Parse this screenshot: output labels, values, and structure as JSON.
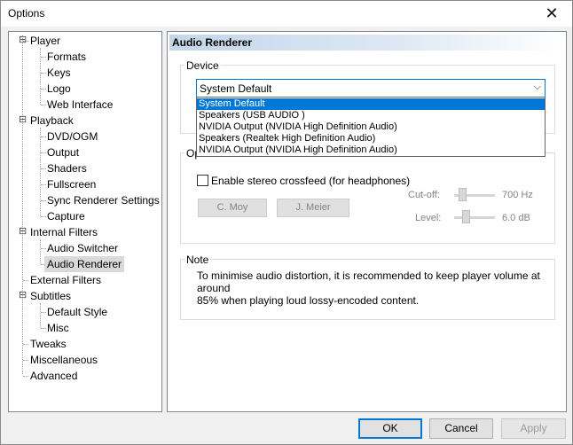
{
  "window": {
    "title": "Options",
    "close_glyph": "✕"
  },
  "tree": {
    "items": [
      {
        "label": "Player",
        "level": 0,
        "expander": "⊟"
      },
      {
        "label": "Formats",
        "level": 1
      },
      {
        "label": "Keys",
        "level": 1
      },
      {
        "label": "Logo",
        "level": 1
      },
      {
        "label": "Web Interface",
        "level": 1
      },
      {
        "label": "Playback",
        "level": 0,
        "expander": "⊟"
      },
      {
        "label": "DVD/OGM",
        "level": 1
      },
      {
        "label": "Output",
        "level": 1
      },
      {
        "label": "Shaders",
        "level": 1
      },
      {
        "label": "Fullscreen",
        "level": 1
      },
      {
        "label": "Sync Renderer Settings",
        "level": 1
      },
      {
        "label": "Capture",
        "level": 1
      },
      {
        "label": "Internal Filters",
        "level": 0,
        "expander": "⊟"
      },
      {
        "label": "Audio Switcher",
        "level": 1
      },
      {
        "label": "Audio Renderer",
        "level": 1,
        "selected": true
      },
      {
        "label": "External Filters",
        "level": 0
      },
      {
        "label": "Subtitles",
        "level": 0,
        "expander": "⊟"
      },
      {
        "label": "Default Style",
        "level": 1
      },
      {
        "label": "Misc",
        "level": 1
      },
      {
        "label": "Tweaks",
        "level": 0
      },
      {
        "label": "Miscellaneous",
        "level": 0
      },
      {
        "label": "Advanced",
        "level": 0
      }
    ]
  },
  "panel": {
    "title": "Audio Renderer",
    "device": {
      "legend": "Device",
      "selected": "System Default",
      "options": [
        "System Default",
        "Speakers (USB  AUDIO  )",
        "NVIDIA Output (NVIDIA High Definition Audio)",
        "Speakers (Realtek High Definition Audio)",
        "NVIDIA Output (NVIDIA High Definition Audio)"
      ]
    },
    "options_group": {
      "legend": "Op",
      "crossfeed_label": "Enable stereo crossfeed (for headphones)",
      "crossfeed_checked": false,
      "cmoy_label": "C. Moy",
      "jmeier_label": "J. Meier",
      "cutoff_label": "Cut-off:",
      "cutoff_value": "700 Hz",
      "level_label": "Level:",
      "level_value": "6.0 dB"
    },
    "note": {
      "legend": "Note",
      "text_line1": "To minimise audio distortion, it is recommended to keep player volume at around",
      "text_line2": "85% when playing loud lossy-encoded content."
    }
  },
  "footer": {
    "ok_label": "OK",
    "cancel_label": "Cancel",
    "apply_label": "Apply"
  }
}
